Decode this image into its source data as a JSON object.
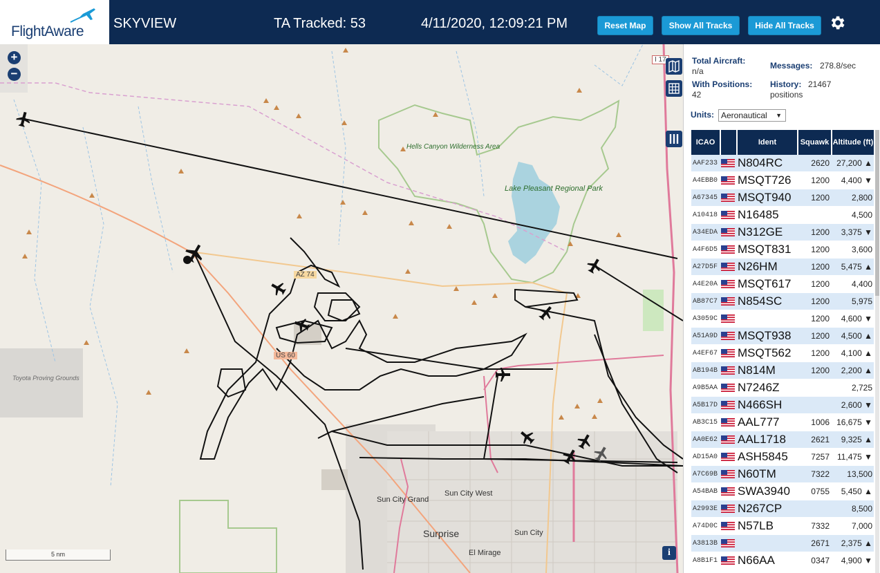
{
  "header": {
    "logo_text": "FlightAware",
    "app_title": "SKYVIEW",
    "tracked": "TA Tracked: 53",
    "datetime": "4/11/2020, 12:09:21 PM",
    "reset_map": "Reset Map",
    "show_all": "Show All Tracks",
    "hide_all": "Hide All Tracks",
    "settings_icon": "gear-icon"
  },
  "map": {
    "zoom_in": "+",
    "zoom_out": "−",
    "scale_label": "5 nm",
    "info_label": "i",
    "labels": {
      "hells_canyon": "Hells Canyon Wilderness Area",
      "lake_pleasant": "Lake Pleasant Regional Park",
      "toyota": "Toyota Proving Grounds",
      "sun_city_grand": "Sun City Grand",
      "sun_city_west": "Sun City West",
      "surprise": "Surprise",
      "sun_city": "Sun City",
      "el_mirage": "El Mirage",
      "az74": "AZ 74",
      "us60": "US 60",
      "i17": "I 17"
    }
  },
  "stats": {
    "total_label": "Total Aircraft:",
    "total_value": "n/a",
    "positions_label": "With Positions:",
    "positions_value": "42",
    "messages_label": "Messages:",
    "messages_value": "278.8/sec",
    "history_label": "History:",
    "history_value": "21467",
    "history_unit": "positions"
  },
  "units": {
    "label": "Units:",
    "selected": "Aeronautical"
  },
  "table": {
    "headers": {
      "icao": "ICAO",
      "ident": "Ident",
      "squawk": "Squawk",
      "altitude": "Altitude (ft)"
    },
    "rows": [
      {
        "icao": "AAF233",
        "ident": "N804RC",
        "squawk": "2620",
        "alt": "27,200 ▲"
      },
      {
        "icao": "A4EBB0",
        "ident": "MSQT726",
        "squawk": "1200",
        "alt": "4,400 ▼"
      },
      {
        "icao": "A67345",
        "ident": "MSQT940",
        "squawk": "1200",
        "alt": "2,800"
      },
      {
        "icao": "A10418",
        "ident": "N16485",
        "squawk": "",
        "alt": "4,500"
      },
      {
        "icao": "A34EDA",
        "ident": "N312GE",
        "squawk": "1200",
        "alt": "3,375 ▼"
      },
      {
        "icao": "A4F6D5",
        "ident": "MSQT831",
        "squawk": "1200",
        "alt": "3,600"
      },
      {
        "icao": "A27D5F",
        "ident": "N26HM",
        "squawk": "1200",
        "alt": "5,475 ▲"
      },
      {
        "icao": "A4E20A",
        "ident": "MSQT617",
        "squawk": "1200",
        "alt": "4,400"
      },
      {
        "icao": "AB87C7",
        "ident": "N854SC",
        "squawk": "1200",
        "alt": "5,975"
      },
      {
        "icao": "A3059C",
        "ident": "",
        "squawk": "1200",
        "alt": "4,600 ▼"
      },
      {
        "icao": "A51A9D",
        "ident": "MSQT938",
        "squawk": "1200",
        "alt": "4,500 ▲"
      },
      {
        "icao": "A4EF67",
        "ident": "MSQT562",
        "squawk": "1200",
        "alt": "4,100 ▲"
      },
      {
        "icao": "AB194B",
        "ident": "N814M",
        "squawk": "1200",
        "alt": "2,200 ▲"
      },
      {
        "icao": "A9B5AA",
        "ident": "N7246Z",
        "squawk": "",
        "alt": "2,725"
      },
      {
        "icao": "A5B17D",
        "ident": "N466SH",
        "squawk": "",
        "alt": "2,600 ▼"
      },
      {
        "icao": "AB3C15",
        "ident": "AAL777",
        "squawk": "1006",
        "alt": "16,675 ▼"
      },
      {
        "icao": "AA0E62",
        "ident": "AAL1718",
        "squawk": "2621",
        "alt": "9,325 ▲"
      },
      {
        "icao": "AD15A0",
        "ident": "ASH5845",
        "squawk": "7257",
        "alt": "11,475 ▼"
      },
      {
        "icao": "A7C69B",
        "ident": "N60TM",
        "squawk": "7322",
        "alt": "13,500"
      },
      {
        "icao": "A54BAB",
        "ident": "SWA3940",
        "squawk": "0755",
        "alt": "5,450 ▲"
      },
      {
        "icao": "A2993E",
        "ident": "N267CP",
        "squawk": "",
        "alt": "8,500"
      },
      {
        "icao": "A74D0C",
        "ident": "N57LB",
        "squawk": "7332",
        "alt": "7,000"
      },
      {
        "icao": "A3813B",
        "ident": "",
        "squawk": "2671",
        "alt": "2,375 ▲"
      },
      {
        "icao": "A8B1F1",
        "ident": "N66AA",
        "squawk": "0347",
        "alt": "4,900 ▼"
      }
    ]
  }
}
